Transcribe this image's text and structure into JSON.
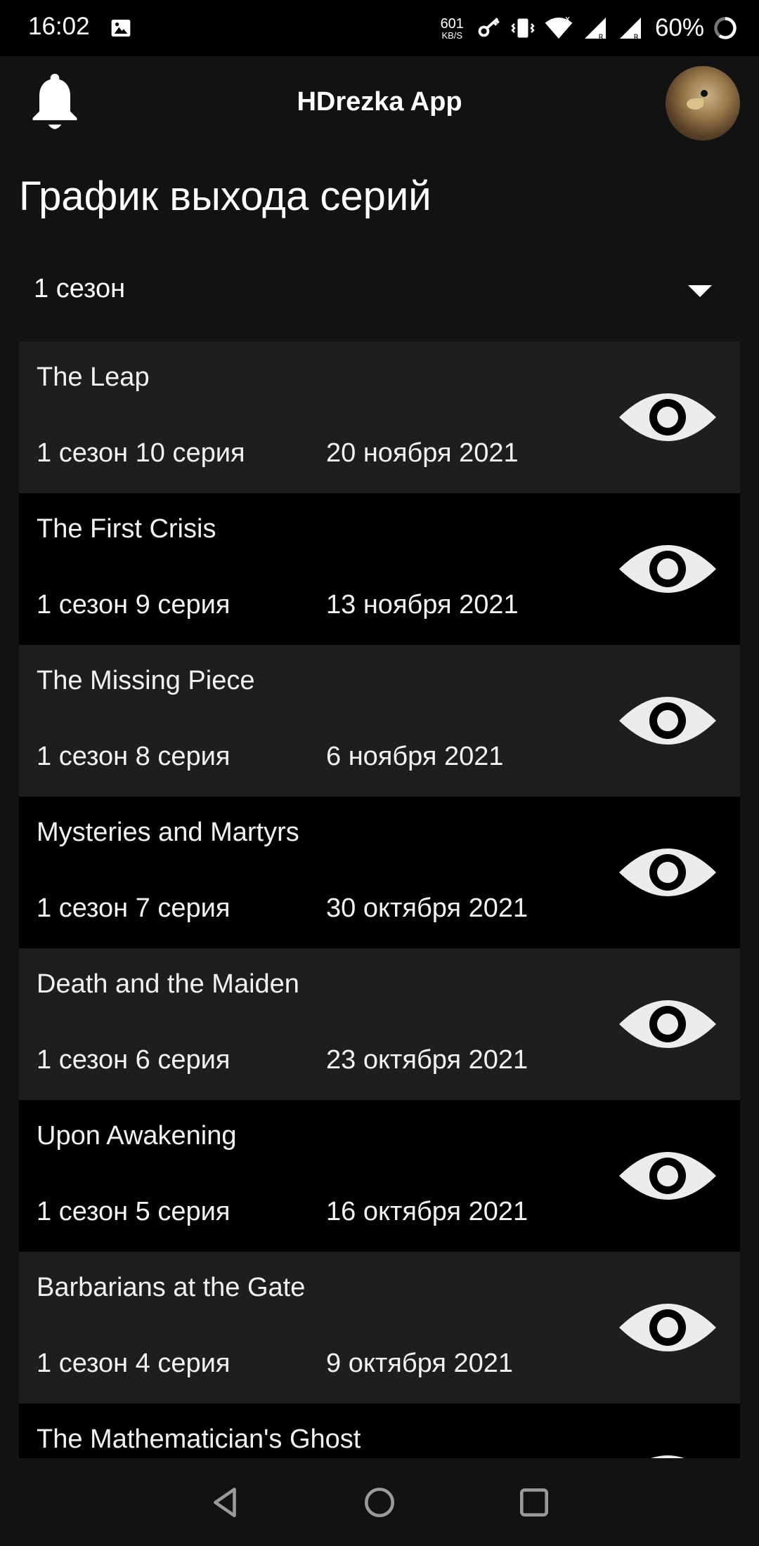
{
  "status_bar": {
    "time": "16:02",
    "net_speed_value": "601",
    "net_speed_unit": "KB/S",
    "battery": "60%",
    "icons": [
      "image-icon",
      "key-icon",
      "vibrate-icon",
      "wifi-icon",
      "signal-icon",
      "signal-icon",
      "battery-ring-icon"
    ]
  },
  "app_bar": {
    "title": "HDrezka App",
    "left_icon": "bell-icon",
    "right_icon": "avatar"
  },
  "page": {
    "title": "График выхода серий",
    "season_select": {
      "value": "1 сезон",
      "icon": "dropdown-caret-icon"
    }
  },
  "episodes": [
    {
      "title": "The Leap",
      "number": "1 сезон 10 серия",
      "date": "20 ноября 2021"
    },
    {
      "title": "The First Crisis",
      "number": "1 сезон 9 серия",
      "date": "13 ноября 2021"
    },
    {
      "title": "The Missing Piece",
      "number": "1 сезон 8 серия",
      "date": "6 ноября 2021"
    },
    {
      "title": "Mysteries and Martyrs",
      "number": "1 сезон 7 серия",
      "date": "30 октября 2021"
    },
    {
      "title": "Death and the Maiden",
      "number": "1 сезон 6 серия",
      "date": "23 октября 2021"
    },
    {
      "title": "Upon Awakening",
      "number": "1 сезон 5 серия",
      "date": "16 октября 2021"
    },
    {
      "title": "Barbarians at the Gate",
      "number": "1 сезон 4 серия",
      "date": "9 октября 2021"
    },
    {
      "title": "The Mathematician's Ghost",
      "number": "",
      "date": ""
    }
  ],
  "nav_bar": {
    "icons": [
      "back-icon",
      "home-icon",
      "recents-icon"
    ]
  },
  "colors": {
    "background": "#121212",
    "row_alt": "#1e1e1e",
    "row": "#000000",
    "text": "#ffffff",
    "eye": "#ececec"
  }
}
